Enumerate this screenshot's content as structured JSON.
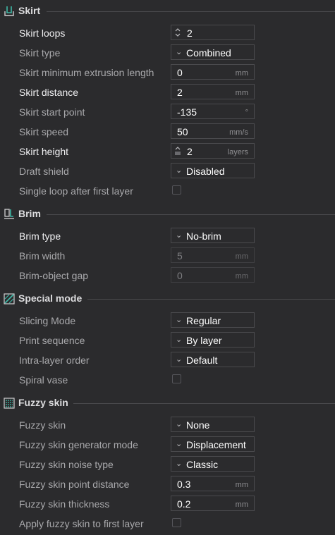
{
  "skirt": {
    "title": "Skirt",
    "rows": [
      {
        "label": "Skirt loops",
        "value": "2"
      },
      {
        "label": "Skirt type",
        "value": "Combined"
      },
      {
        "label": "Skirt minimum extrusion length",
        "value": "0",
        "unit": "mm"
      },
      {
        "label": "Skirt distance",
        "value": "2",
        "unit": "mm"
      },
      {
        "label": "Skirt start point",
        "value": "-135",
        "unit": "°"
      },
      {
        "label": "Skirt speed",
        "value": "50",
        "unit": "mm/s"
      },
      {
        "label": "Skirt height",
        "value": "2",
        "unit": "layers"
      },
      {
        "label": "Draft shield",
        "value": "Disabled"
      },
      {
        "label": "Single loop after first layer",
        "checked": false
      }
    ]
  },
  "brim": {
    "title": "Brim",
    "rows": [
      {
        "label": "Brim type",
        "value": "No-brim"
      },
      {
        "label": "Brim width",
        "value": "5",
        "unit": "mm"
      },
      {
        "label": "Brim-object gap",
        "value": "0",
        "unit": "mm"
      }
    ]
  },
  "special_mode": {
    "title": "Special mode",
    "rows": [
      {
        "label": "Slicing Mode",
        "value": "Regular"
      },
      {
        "label": "Print sequence",
        "value": "By layer"
      },
      {
        "label": "Intra-layer order",
        "value": "Default"
      },
      {
        "label": "Spiral vase",
        "checked": false
      }
    ]
  },
  "fuzzy_skin": {
    "title": "Fuzzy skin",
    "rows": [
      {
        "label": "Fuzzy skin",
        "value": "None"
      },
      {
        "label": "Fuzzy skin generator mode",
        "value": "Displacement"
      },
      {
        "label": "Fuzzy skin noise type",
        "value": "Classic"
      },
      {
        "label": "Fuzzy skin point distance",
        "value": "0.3",
        "unit": "mm"
      },
      {
        "label": "Fuzzy skin thickness",
        "value": "0.2",
        "unit": "mm"
      },
      {
        "label": "Apply fuzzy skin to first layer",
        "checked": false
      }
    ]
  },
  "icons": {
    "skirt": "skirt-icon",
    "brim": "brim-icon",
    "special_mode": "special-mode-icon",
    "fuzzy_skin": "fuzzy-skin-icon",
    "dropdown": "chevron-down-icon",
    "spinner": "spin-arrows-icon"
  },
  "colors": {
    "background": "#2b2b2d",
    "text_strong": "#f0f0f2",
    "text_normal": "#a9a9ac",
    "border": "#4a4a4d"
  }
}
